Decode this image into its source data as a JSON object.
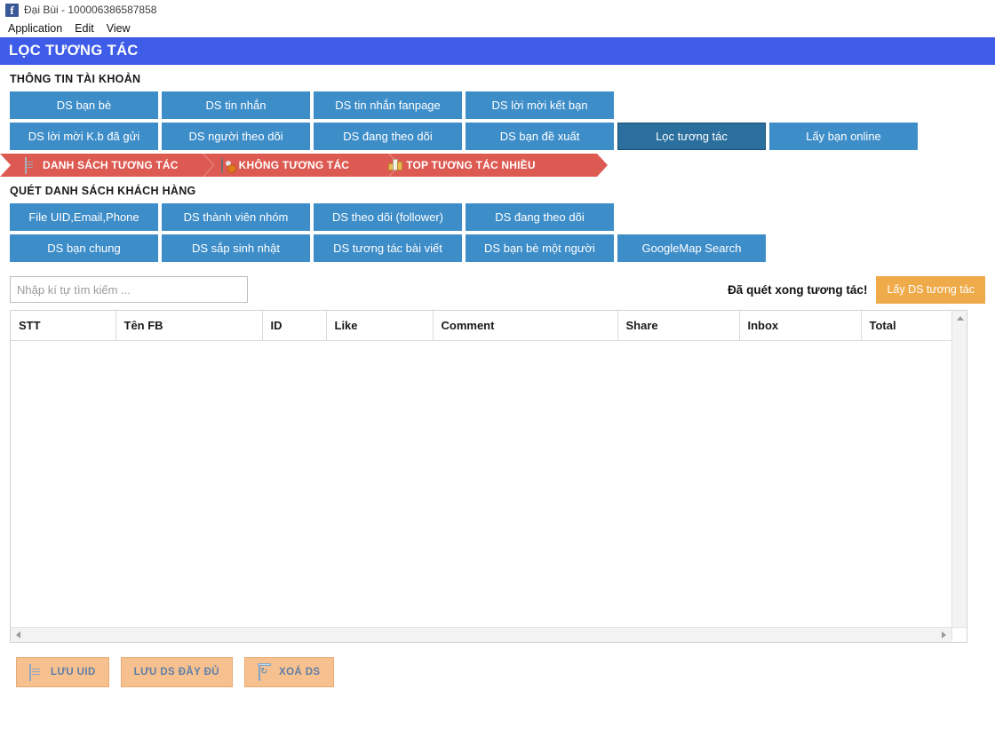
{
  "window": {
    "icon": "facebook-logo-icon",
    "title": "Đại Bùi - 100006386587858"
  },
  "menu": {
    "items": [
      {
        "label": "Application"
      },
      {
        "label": "Edit"
      },
      {
        "label": "View"
      }
    ]
  },
  "banner": {
    "title": "LỌC TƯƠNG TÁC",
    "color": "#3f5ce8"
  },
  "account_section": {
    "label": "THÔNG TIN TÀI KHOẢN",
    "buttons": [
      {
        "label": "DS bạn bè",
        "selected": false
      },
      {
        "label": "DS tin nhắn",
        "selected": false
      },
      {
        "label": "DS tin nhắn fanpage",
        "selected": false
      },
      {
        "label": "DS lời mời kết bạn",
        "selected": false
      },
      {
        "label": "DS lời mời K.b đã gửi",
        "selected": false
      },
      {
        "label": "DS người theo dõi",
        "selected": false
      },
      {
        "label": "DS đang theo dõi",
        "selected": false
      },
      {
        "label": "DS bạn đề xuất",
        "selected": false
      },
      {
        "label": "Lọc tương tác",
        "selected": true
      },
      {
        "label": "Lấy bạn online",
        "selected": false
      }
    ]
  },
  "ribbon": {
    "color": "#dd5a52",
    "tabs": [
      {
        "label": "DANH SÁCH TƯƠNG TÁC",
        "icon": "document-icon"
      },
      {
        "label": "KHÔNG TƯƠNG TÁC",
        "icon": "user-blocked-icon"
      },
      {
        "label": "TOP TƯƠNG TÁC NHIỀU",
        "icon": "bar-chart-icon"
      }
    ]
  },
  "scan_section": {
    "label": "QUÉT DANH SÁCH KHÁCH HÀNG",
    "buttons": [
      {
        "label": "File UID,Email,Phone",
        "selected": false
      },
      {
        "label": "DS thành viên nhóm",
        "selected": false
      },
      {
        "label": "DS theo dõi (follower)",
        "selected": false
      },
      {
        "label": "DS đang theo dõi",
        "selected": false
      },
      {
        "label": "DS bạn chung",
        "selected": false
      },
      {
        "label": "DS sắp sinh nhật",
        "selected": false
      },
      {
        "label": "DS tương tác bài viết",
        "selected": false
      },
      {
        "label": "DS bạn bè một người",
        "selected": false
      },
      {
        "label": "GoogleMap Search",
        "selected": false
      }
    ]
  },
  "search": {
    "value": "",
    "placeholder": "Nhập kí tự tìm kiếm ..."
  },
  "status": {
    "message": "Đã quét xong tương tác!",
    "action_label": "Lấy DS tương tác",
    "action_color": "#efab4a"
  },
  "table": {
    "columns": [
      {
        "label": "STT"
      },
      {
        "label": "Tên FB"
      },
      {
        "label": "ID"
      },
      {
        "label": "Like"
      },
      {
        "label": "Comment"
      },
      {
        "label": "Share"
      },
      {
        "label": "Inbox"
      },
      {
        "label": "Total"
      }
    ],
    "rows": []
  },
  "bottom_actions": [
    {
      "label": "LƯU UID",
      "icon": "save-document-icon"
    },
    {
      "label": "LƯU DS ĐẦY ĐỦ",
      "icon": "none"
    },
    {
      "label": "XOÁ DS",
      "icon": "trash-recycle-icon"
    }
  ]
}
